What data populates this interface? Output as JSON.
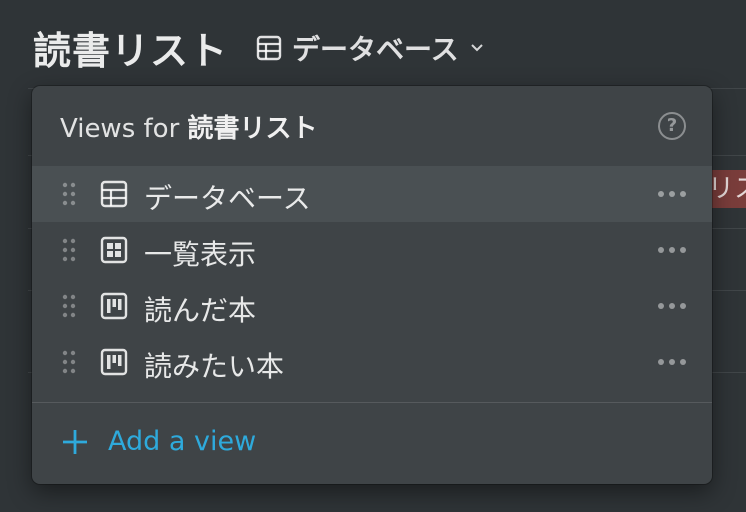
{
  "page": {
    "title": "読書リスト",
    "current_view": "データベース"
  },
  "popup": {
    "header_prefix": "Views for ",
    "header_db": "読書リスト",
    "help_symbol": "?",
    "views": [
      {
        "label": "データベース",
        "icon": "table-icon",
        "active": true
      },
      {
        "label": "一覧表示",
        "icon": "gallery-icon",
        "active": false
      },
      {
        "label": "読んだ本",
        "icon": "board-icon",
        "active": false
      },
      {
        "label": "読みたい本",
        "icon": "board-icon",
        "active": false
      }
    ],
    "add_view_label": "Add a view",
    "accent_color": "#2eaadc"
  },
  "background": {
    "tag_fragment": "リス"
  }
}
